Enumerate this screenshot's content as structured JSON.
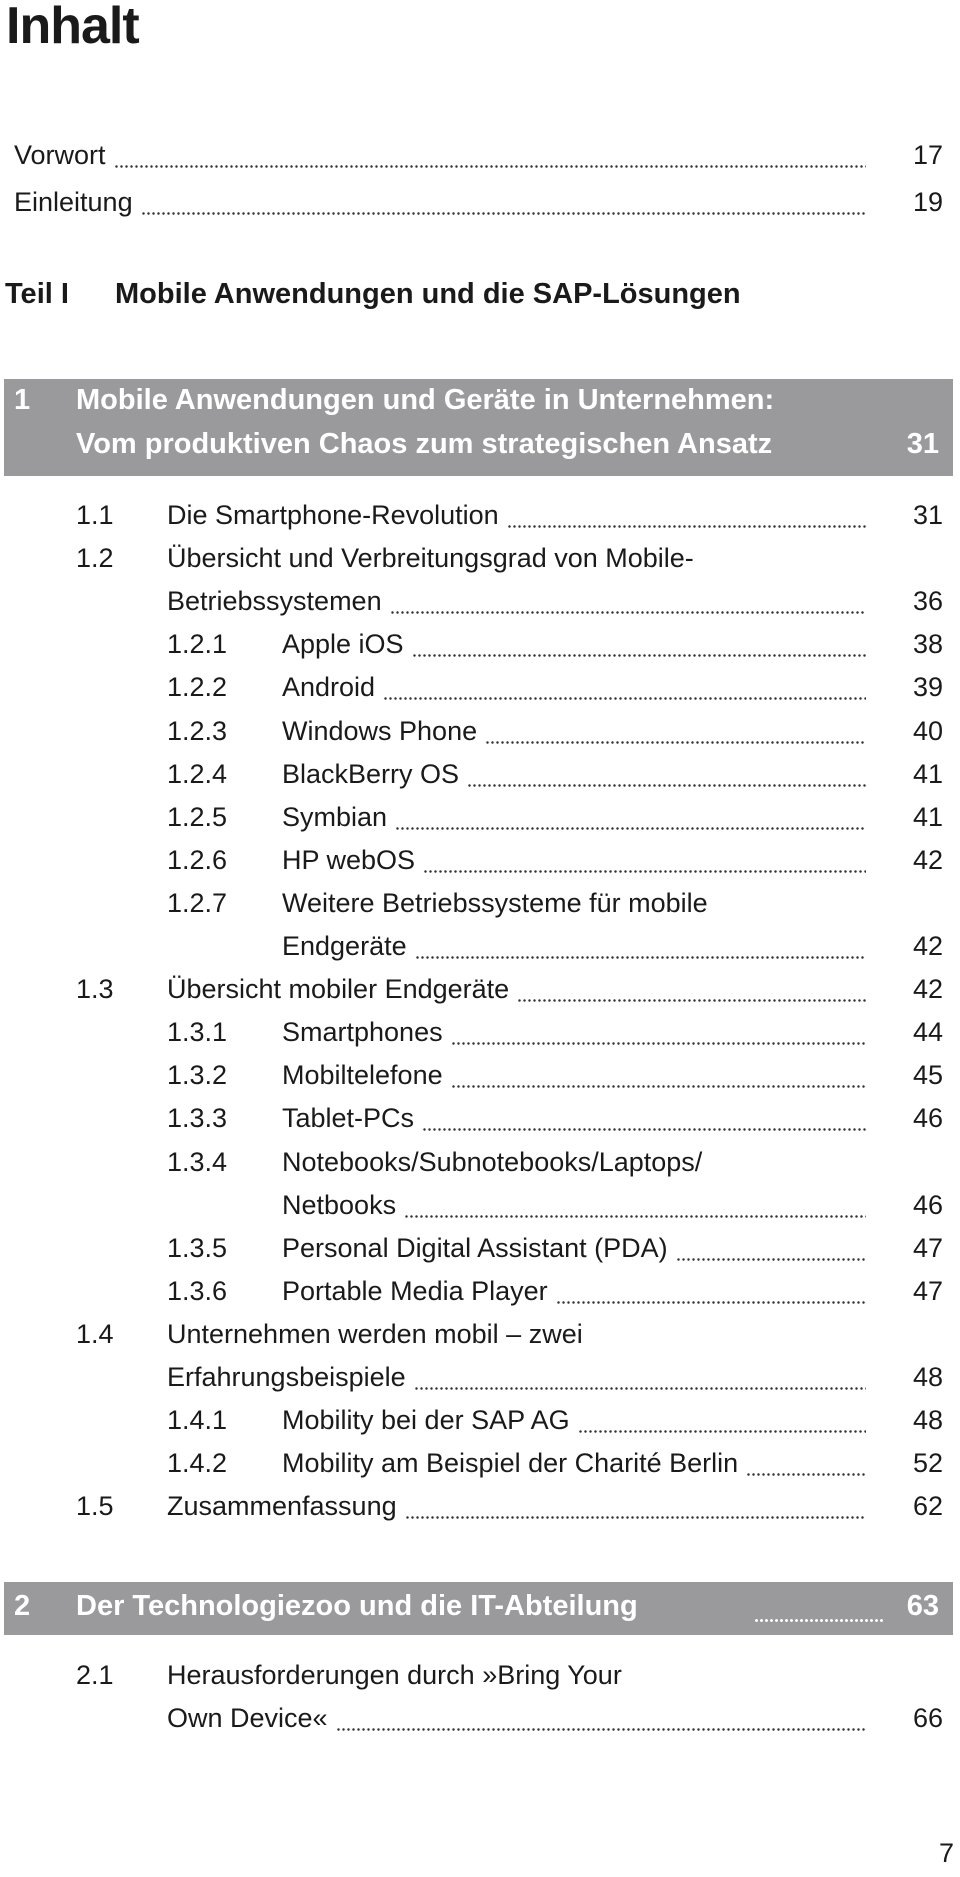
{
  "heading": "Inhalt",
  "front": [
    {
      "title": "Vorwort",
      "page": "17"
    },
    {
      "title": "Einleitung",
      "page": "19"
    }
  ],
  "part": {
    "label": "Teil I",
    "title": "Mobile Anwendungen und die SAP-Lösungen"
  },
  "chapter1": {
    "num": "1",
    "line1": "Mobile Anwendungen und Geräte in Unternehmen:",
    "line2": "Vom produktiven Chaos zum strategischen Ansatz",
    "page": "31"
  },
  "entries1": [
    {
      "num": "1.1",
      "lines": [
        "Die Smartphone-Revolution"
      ],
      "page": "31",
      "level": 2
    },
    {
      "num": "1.2",
      "lines": [
        "Übersicht und Verbreitungsgrad von Mobile-",
        "Betriebssystemen"
      ],
      "page": "36",
      "level": 2
    },
    {
      "num": "1.2.1",
      "lines": [
        "Apple iOS"
      ],
      "page": "38",
      "level": 3
    },
    {
      "num": "1.2.2",
      "lines": [
        "Android"
      ],
      "page": "39",
      "level": 3
    },
    {
      "num": "1.2.3",
      "lines": [
        "Windows Phone"
      ],
      "page": "40",
      "level": 3
    },
    {
      "num": "1.2.4",
      "lines": [
        "BlackBerry OS"
      ],
      "page": "41",
      "level": 3
    },
    {
      "num": "1.2.5",
      "lines": [
        "Symbian"
      ],
      "page": "41",
      "level": 3
    },
    {
      "num": "1.2.6",
      "lines": [
        "HP webOS"
      ],
      "page": "42",
      "level": 3
    },
    {
      "num": "1.2.7",
      "lines": [
        "Weitere Betriebssysteme für mobile",
        "Endgeräte"
      ],
      "page": "42",
      "level": 3
    },
    {
      "num": "1.3",
      "lines": [
        "Übersicht mobiler Endgeräte"
      ],
      "page": "42",
      "level": 2
    },
    {
      "num": "1.3.1",
      "lines": [
        "Smartphones"
      ],
      "page": "44",
      "level": 3
    },
    {
      "num": "1.3.2",
      "lines": [
        "Mobiltelefone"
      ],
      "page": "45",
      "level": 3
    },
    {
      "num": "1.3.3",
      "lines": [
        "Tablet-PCs"
      ],
      "page": "46",
      "level": 3
    },
    {
      "num": "1.3.4",
      "lines": [
        "Notebooks/Subnotebooks/Laptops/",
        "Netbooks"
      ],
      "page": "46",
      "level": 3
    },
    {
      "num": "1.3.5",
      "lines": [
        "Personal Digital Assistant (PDA)"
      ],
      "page": "47",
      "level": 3
    },
    {
      "num": "1.3.6",
      "lines": [
        "Portable Media Player"
      ],
      "page": "47",
      "level": 3
    },
    {
      "num": "1.4",
      "lines": [
        "Unternehmen werden mobil – zwei",
        "Erfahrungsbeispiele"
      ],
      "page": "48",
      "level": 2
    },
    {
      "num": "1.4.1",
      "lines": [
        "Mobility bei der SAP AG"
      ],
      "page": "48",
      "level": 3
    },
    {
      "num": "1.4.2",
      "lines": [
        "Mobility am Beispiel der Charité Berlin"
      ],
      "page": "52",
      "level": 3
    },
    {
      "num": "1.5",
      "lines": [
        "Zusammenfassung"
      ],
      "page": "62",
      "level": 2
    }
  ],
  "chapter2": {
    "num": "2",
    "title": "Der Technologiezoo und die IT-Abteilung",
    "page": "63"
  },
  "entries2": [
    {
      "num": "2.1",
      "lines": [
        "Herausforderungen durch »Bring Your",
        "Own Device«"
      ],
      "page": "66",
      "level": 2
    }
  ],
  "page_number": "7",
  "colors": {
    "chapter_bar": "#9a9a9c",
    "text": "#1a1a1a"
  }
}
